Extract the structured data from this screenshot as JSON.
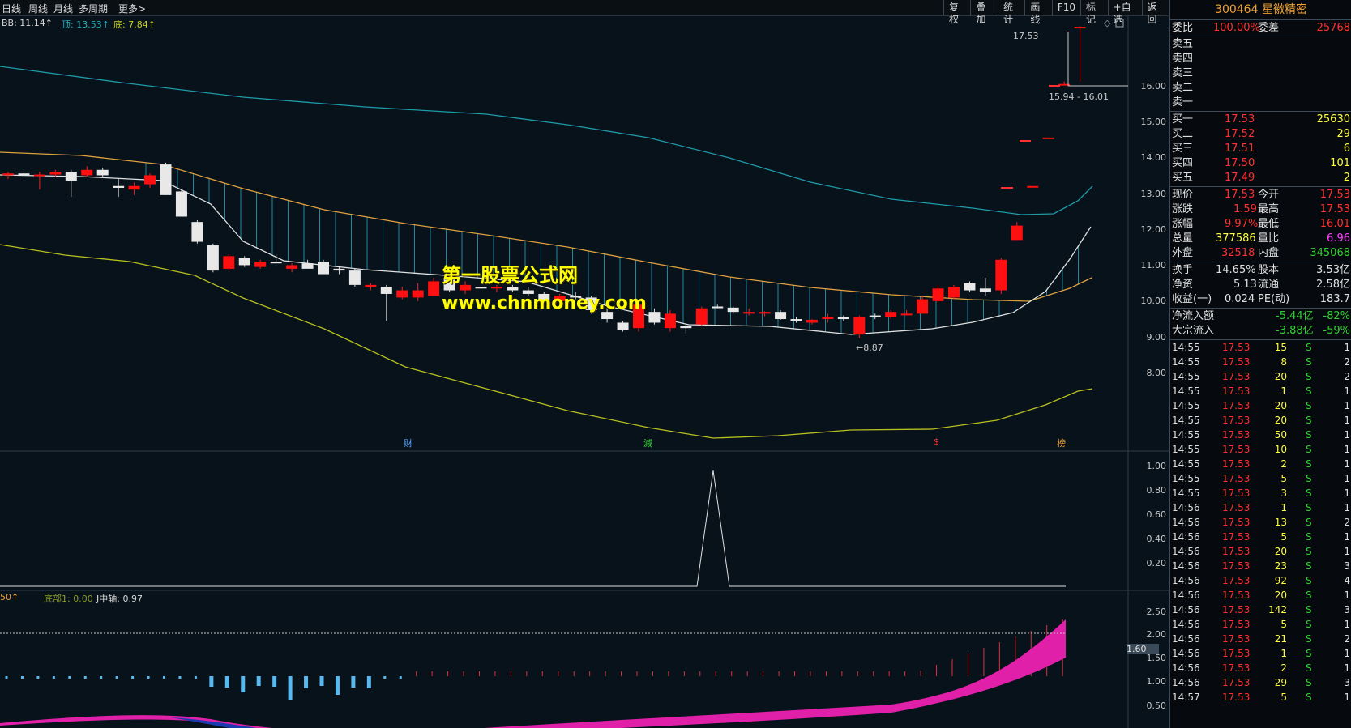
{
  "toolbar": {
    "periods": [
      "日线",
      "周线",
      "月线",
      "多周期",
      "更多>"
    ],
    "tools": [
      "复权",
      "叠加",
      "统计",
      "画线",
      "F10",
      "标记",
      "+自选",
      "返回"
    ]
  },
  "indicator_legend": {
    "bb": "BB: 11.14↑",
    "top": "顶: 13.53↑",
    "bottom": "底: 7.84↑",
    "sub2_left": "50↑",
    "sub2_bottom1": "底部1: 0.00",
    "sub2_jaxis": "J中轴: 0.97"
  },
  "price_annotations": {
    "high": "17.53",
    "range": "15.94 - 16.01",
    "low": "←8.87"
  },
  "axis_main": [
    "16.00",
    "15.00",
    "14.00",
    "13.00",
    "12.00",
    "11.00",
    "10.00",
    "9.00",
    "8.00"
  ],
  "axis_sub1": [
    "1.00",
    "0.80",
    "0.60",
    "0.40",
    "0.20"
  ],
  "axis_sub2": [
    "2.50",
    "2.00",
    "1.60",
    "1.50",
    "1.00",
    "0.50"
  ],
  "event_markers": [
    "财",
    "減",
    "$",
    "榜"
  ],
  "watermark": {
    "line1": "第一股票公式网",
    "line2": "www.chnmoney.com"
  },
  "stock": {
    "code": "300464",
    "name": "星徽精密"
  },
  "order_ratio": {
    "label1": "委比",
    "value1": "100.00%",
    "label2": "委差",
    "value2": "25768"
  },
  "sell_levels": [
    "卖五",
    "卖四",
    "卖三",
    "卖二",
    "卖一"
  ],
  "buy_levels": [
    {
      "label": "买一",
      "price": "17.53",
      "vol": "25630"
    },
    {
      "label": "买二",
      "price": "17.52",
      "vol": "29"
    },
    {
      "label": "买三",
      "price": "17.51",
      "vol": "6"
    },
    {
      "label": "买四",
      "price": "17.50",
      "vol": "101"
    },
    {
      "label": "买五",
      "price": "17.49",
      "vol": "2"
    }
  ],
  "quote": [
    {
      "l1": "现价",
      "v1": "17.53",
      "l2": "今开",
      "v2": "17.53"
    },
    {
      "l1": "涨跌",
      "v1": "1.59",
      "l2": "最高",
      "v2": "17.53"
    },
    {
      "l1": "涨幅",
      "v1": "9.97%",
      "l2": "最低",
      "v2": "16.01"
    },
    {
      "l1": "总量",
      "v1": "377586",
      "l2": "量比",
      "v2": "6.96"
    },
    {
      "l1": "外盘",
      "v1": "32518",
      "l2": "内盘",
      "v2": "345068"
    }
  ],
  "fundamentals": [
    {
      "l1": "换手",
      "v1": "14.65%",
      "l2": "股本",
      "v2": "3.53亿"
    },
    {
      "l1": "净资",
      "v1": "5.13",
      "l2": "流通",
      "v2": "2.58亿"
    },
    {
      "l1": "收益(一)",
      "v1": "0.024",
      "l2": "PE(动)",
      "v2": "183.7"
    }
  ],
  "flows": [
    {
      "label": "净流入额",
      "value": "-5.44亿",
      "pct": "-82%"
    },
    {
      "label": "大宗流入",
      "value": "-3.88亿",
      "pct": "-59%"
    }
  ],
  "colors": {
    "up": "#ff3030",
    "down": "#30d030",
    "accent": "#f0a030",
    "background": "#07121b"
  },
  "ticks": [
    {
      "time": "14:55",
      "price": "17.53",
      "vol": "15",
      "side": "S",
      "n": "1"
    },
    {
      "time": "14:55",
      "price": "17.53",
      "vol": "8",
      "side": "S",
      "n": "2"
    },
    {
      "time": "14:55",
      "price": "17.53",
      "vol": "20",
      "side": "S",
      "n": "2"
    },
    {
      "time": "14:55",
      "price": "17.53",
      "vol": "1",
      "side": "S",
      "n": "1"
    },
    {
      "time": "14:55",
      "price": "17.53",
      "vol": "20",
      "side": "S",
      "n": "1"
    },
    {
      "time": "14:55",
      "price": "17.53",
      "vol": "20",
      "side": "S",
      "n": "1"
    },
    {
      "time": "14:55",
      "price": "17.53",
      "vol": "50",
      "side": "S",
      "n": "1"
    },
    {
      "time": "14:55",
      "price": "17.53",
      "vol": "10",
      "side": "S",
      "n": "1"
    },
    {
      "time": "14:55",
      "price": "17.53",
      "vol": "2",
      "side": "S",
      "n": "1"
    },
    {
      "time": "14:55",
      "price": "17.53",
      "vol": "5",
      "side": "S",
      "n": "1"
    },
    {
      "time": "14:55",
      "price": "17.53",
      "vol": "3",
      "side": "S",
      "n": "1"
    },
    {
      "time": "14:56",
      "price": "17.53",
      "vol": "1",
      "side": "S",
      "n": "1"
    },
    {
      "time": "14:56",
      "price": "17.53",
      "vol": "13",
      "side": "S",
      "n": "2"
    },
    {
      "time": "14:56",
      "price": "17.53",
      "vol": "5",
      "side": "S",
      "n": "1"
    },
    {
      "time": "14:56",
      "price": "17.53",
      "vol": "20",
      "side": "S",
      "n": "1"
    },
    {
      "time": "14:56",
      "price": "17.53",
      "vol": "23",
      "side": "S",
      "n": "3"
    },
    {
      "time": "14:56",
      "price": "17.53",
      "vol": "92",
      "side": "S",
      "n": "4"
    },
    {
      "time": "14:56",
      "price": "17.53",
      "vol": "20",
      "side": "S",
      "n": "1"
    },
    {
      "time": "14:56",
      "price": "17.53",
      "vol": "142",
      "side": "S",
      "n": "3"
    },
    {
      "time": "14:56",
      "price": "17.53",
      "vol": "5",
      "side": "S",
      "n": "1"
    },
    {
      "time": "14:56",
      "price": "17.53",
      "vol": "21",
      "side": "S",
      "n": "2"
    },
    {
      "time": "14:56",
      "price": "17.53",
      "vol": "1",
      "side": "S",
      "n": "1"
    },
    {
      "time": "14:56",
      "price": "17.53",
      "vol": "2",
      "side": "S",
      "n": "1"
    },
    {
      "time": "14:56",
      "price": "17.53",
      "vol": "29",
      "side": "S",
      "n": "3"
    },
    {
      "time": "14:57",
      "price": "17.53",
      "vol": "5",
      "side": "S",
      "n": "1"
    }
  ],
  "candles": [
    [
      13.4,
      13.5,
      13.3,
      13.45
    ],
    [
      13.45,
      13.55,
      13.35,
      13.4
    ],
    [
      13.4,
      13.5,
      13.0,
      13.42
    ],
    [
      13.42,
      13.55,
      13.35,
      13.5
    ],
    [
      13.5,
      13.55,
      12.8,
      13.25
    ],
    [
      13.4,
      13.65,
      13.35,
      13.55
    ],
    [
      13.55,
      13.6,
      13.35,
      13.4
    ],
    [
      13.1,
      13.3,
      12.8,
      13.05
    ],
    [
      13.0,
      13.2,
      12.85,
      13.1
    ],
    [
      13.15,
      13.45,
      13.05,
      13.4
    ],
    [
      13.7,
      13.75,
      12.85,
      12.85
    ],
    [
      12.95,
      13.0,
      12.25,
      12.25
    ],
    [
      12.1,
      12.15,
      11.5,
      11.55
    ],
    [
      11.45,
      11.5,
      10.7,
      10.75
    ],
    [
      10.8,
      11.2,
      10.75,
      11.15
    ],
    [
      11.1,
      11.15,
      10.85,
      10.9
    ],
    [
      10.85,
      11.05,
      10.8,
      11.0
    ],
    [
      11.0,
      11.2,
      10.95,
      10.95
    ],
    [
      10.8,
      10.95,
      10.7,
      10.9
    ],
    [
      10.95,
      11.05,
      10.85,
      10.8
    ],
    [
      11.0,
      11.05,
      10.65,
      10.65
    ],
    [
      10.8,
      10.85,
      10.65,
      10.75
    ],
    [
      10.75,
      10.8,
      10.3,
      10.35
    ],
    [
      10.3,
      10.4,
      10.2,
      10.35
    ],
    [
      10.3,
      10.35,
      9.35,
      10.1
    ],
    [
      10.0,
      10.3,
      9.95,
      10.2
    ],
    [
      10.0,
      10.4,
      9.9,
      10.2
    ],
    [
      10.05,
      10.55,
      10.05,
      10.45
    ],
    [
      10.55,
      10.6,
      10.15,
      10.2
    ],
    [
      10.2,
      10.45,
      10.1,
      10.35
    ],
    [
      10.3,
      10.4,
      10.2,
      10.25
    ],
    [
      10.25,
      10.35,
      10.15,
      10.3
    ],
    [
      10.3,
      10.35,
      10.15,
      10.2
    ],
    [
      10.2,
      10.3,
      10.05,
      10.1
    ],
    [
      10.1,
      10.15,
      9.85,
      9.9
    ],
    [
      9.9,
      10.1,
      9.85,
      10.05
    ],
    [
      10.05,
      10.15,
      9.95,
      10.0
    ],
    [
      10.0,
      10.05,
      9.55,
      9.65
    ],
    [
      9.6,
      9.7,
      9.3,
      9.4
    ],
    [
      9.3,
      9.35,
      9.05,
      9.1
    ],
    [
      9.15,
      9.85,
      9.05,
      9.8
    ],
    [
      9.6,
      9.7,
      9.25,
      9.3
    ],
    [
      9.15,
      9.65,
      9.05,
      9.55
    ],
    [
      9.2,
      9.25,
      9.0,
      9.15
    ],
    [
      9.25,
      9.75,
      9.2,
      9.7
    ],
    [
      9.75,
      9.8,
      9.7,
      9.72
    ],
    [
      9.72,
      9.75,
      9.55,
      9.6
    ],
    [
      9.55,
      9.7,
      9.5,
      9.6
    ],
    [
      9.55,
      9.62,
      9.48,
      9.6
    ],
    [
      9.6,
      9.65,
      9.38,
      9.4
    ],
    [
      9.4,
      9.45,
      9.3,
      9.35
    ],
    [
      9.3,
      9.4,
      9.25,
      9.38
    ],
    [
      9.4,
      9.55,
      9.3,
      9.45
    ],
    [
      9.45,
      9.5,
      9.35,
      9.4
    ],
    [
      8.97,
      9.5,
      8.87,
      9.45
    ],
    [
      9.5,
      9.55,
      9.4,
      9.45
    ],
    [
      9.45,
      9.65,
      9.4,
      9.6
    ],
    [
      9.55,
      9.65,
      9.5,
      9.55
    ],
    [
      9.55,
      10.05,
      9.55,
      9.95
    ],
    [
      9.9,
      10.35,
      9.85,
      10.25
    ],
    [
      10.0,
      10.35,
      9.95,
      10.3
    ],
    [
      10.4,
      10.45,
      10.15,
      10.2
    ],
    [
      10.25,
      10.55,
      10.05,
      10.15
    ],
    [
      10.2,
      11.1,
      10.1,
      11.05
    ],
    [
      11.6,
      12.1,
      11.6,
      12.0
    ],
    [
      13.1,
      13.1,
      13.1,
      13.1
    ],
    [
      14.45,
      14.45,
      14.45,
      14.45
    ],
    [
      15.94,
      16.01,
      15.94,
      15.94
    ],
    [
      17.53,
      17.53,
      16.01,
      17.53
    ]
  ]
}
